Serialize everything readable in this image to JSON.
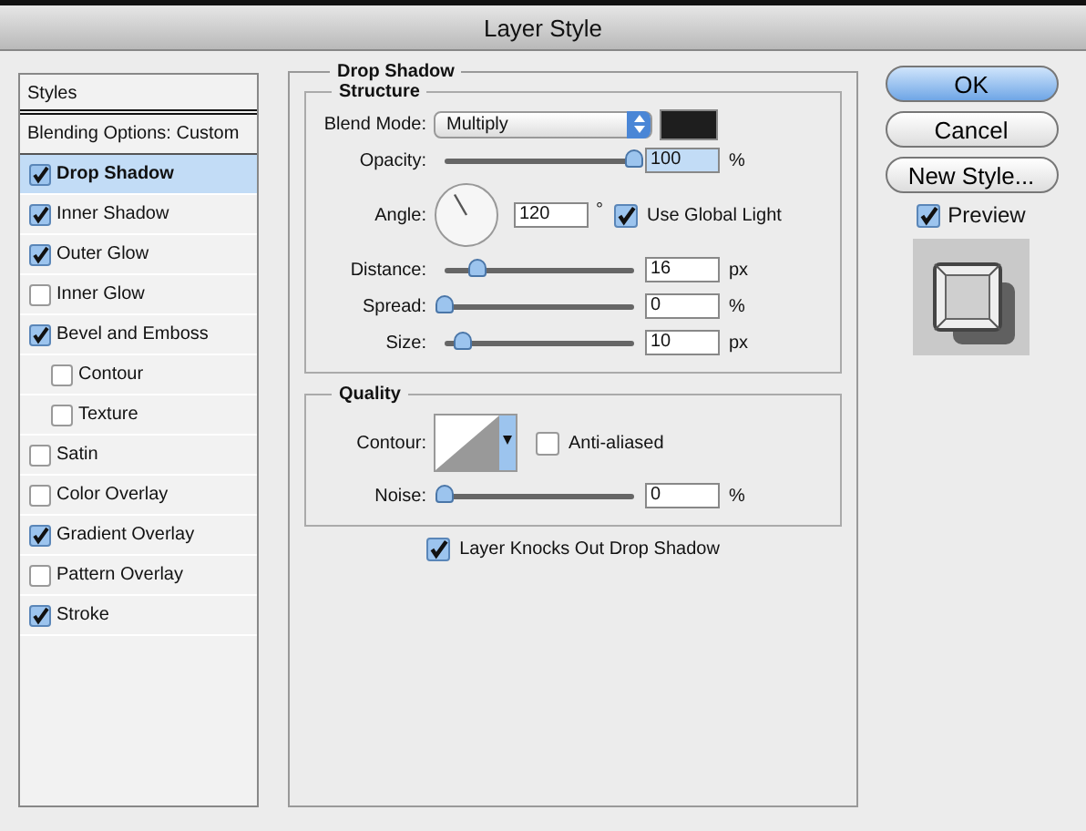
{
  "window": {
    "title": "Layer Style"
  },
  "styles_list": {
    "header": "Styles",
    "blending": "Blending Options: Custom",
    "items": [
      {
        "label": "Drop Shadow",
        "checked": true,
        "selected": true
      },
      {
        "label": "Inner Shadow",
        "checked": true,
        "selected": false
      },
      {
        "label": "Outer Glow",
        "checked": true,
        "selected": false
      },
      {
        "label": "Inner Glow",
        "checked": false,
        "selected": false
      },
      {
        "label": "Bevel and Emboss",
        "checked": true,
        "selected": false,
        "children": [
          {
            "label": "Contour",
            "checked": false,
            "selected": false
          },
          {
            "label": "Texture",
            "checked": false,
            "selected": false
          }
        ]
      },
      {
        "label": "Satin",
        "checked": false,
        "selected": false
      },
      {
        "label": "Color Overlay",
        "checked": false,
        "selected": false
      },
      {
        "label": "Gradient Overlay",
        "checked": true,
        "selected": false
      },
      {
        "label": "Pattern Overlay",
        "checked": false,
        "selected": false
      },
      {
        "label": "Stroke",
        "checked": true,
        "selected": false
      }
    ]
  },
  "drop_shadow": {
    "title": "Drop Shadow",
    "structure": {
      "title": "Structure",
      "blend_mode": {
        "label": "Blend Mode:",
        "value": "Multiply",
        "color": "#1e1e1e"
      },
      "opacity": {
        "label": "Opacity:",
        "level": 1.0,
        "value": "100",
        "unit": "%"
      },
      "angle": {
        "label": "Angle:",
        "value": "120",
        "unit": "°",
        "global_light": {
          "label": "Use Global Light",
          "checked": true
        }
      },
      "sliders": [
        {
          "label": "Distance:",
          "level": 0.17,
          "value": "16",
          "unit": "px"
        },
        {
          "label": "Spread:",
          "level": 0.0,
          "value": "0",
          "unit": "%"
        },
        {
          "label": "Size:",
          "level": 0.1,
          "value": "10",
          "unit": "px"
        }
      ]
    },
    "quality": {
      "title": "Quality",
      "contour_label": "Contour:",
      "anti_aliased": {
        "label": "Anti-aliased",
        "checked": false
      },
      "noise": {
        "label": "Noise:",
        "level": 0.0,
        "value": "0",
        "unit": "%"
      }
    },
    "knockout": {
      "label": "Layer Knocks Out Drop Shadow",
      "checked": true
    }
  },
  "buttons": [
    {
      "label": "OK",
      "default": true
    },
    {
      "label": "Cancel",
      "default": false
    },
    {
      "label": "New Style...",
      "default": false
    }
  ],
  "preview": {
    "label": "Preview",
    "checked": true
  }
}
